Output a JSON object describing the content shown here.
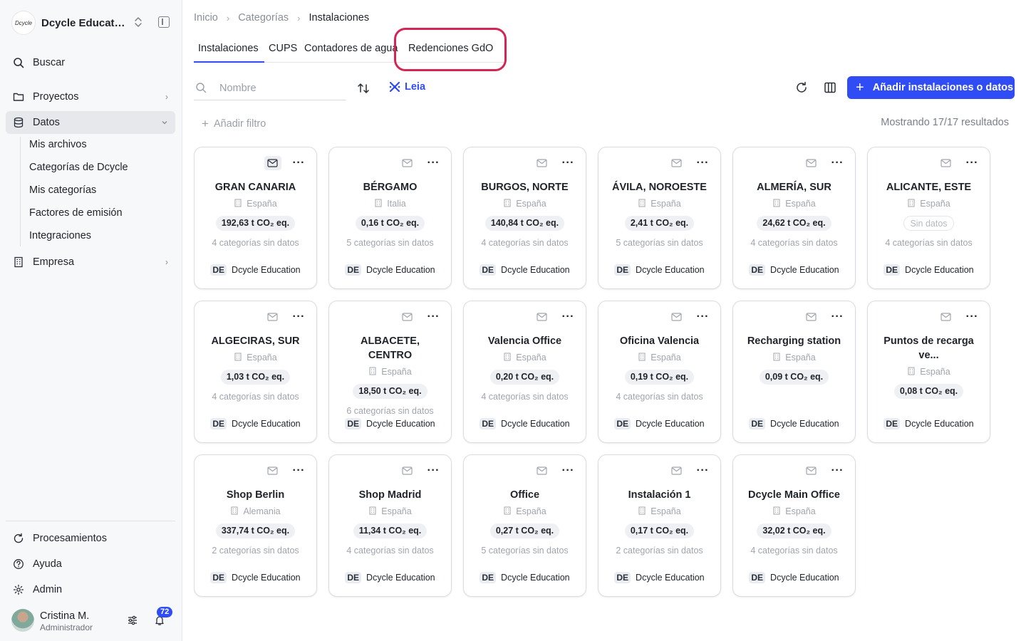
{
  "sidebar": {
    "org_logo_text": "Dcycle",
    "org_name": "Dcycle Education",
    "search_label": "Buscar",
    "projects_label": "Proyectos",
    "data_label": "Datos",
    "data_subitems": [
      "Mis archivos",
      "Categorías de Dcycle",
      "Mis categorías",
      "Factores de emisión",
      "Integraciones"
    ],
    "company_label": "Empresa",
    "processing_label": "Procesamientos",
    "help_label": "Ayuda",
    "admin_label": "Admin",
    "user_name": "Cristina M.",
    "user_role": "Administrador",
    "notifications_count": "72"
  },
  "breadcrumb": [
    "Inicio",
    "Categorías",
    "Instalaciones"
  ],
  "tabs": [
    "Instalaciones",
    "CUPS",
    "Contadores de agua",
    "Redenciones GdO"
  ],
  "active_tab": "Instalaciones",
  "toolbar": {
    "search_placeholder": "Nombre",
    "leia_label": "Leia",
    "add_button_label": "Añadir instalaciones o datos",
    "add_filter_label": "Añadir filtro",
    "results_text": "Mostrando 17/17 resultados"
  },
  "colors": {
    "accent": "#2f4cf5",
    "highlight": "#d42655"
  },
  "cards": [
    {
      "title": "GRAN CANARIA",
      "country": "España",
      "co2": "192,63 t CO₂ eq.",
      "nodata": "4 categorías sin datos",
      "owner_initials": "DE",
      "owner": "Dcycle Education",
      "mail_active": true
    },
    {
      "title": "BÉRGAMO",
      "country": "Italia",
      "co2": "0,16 t CO₂ eq.",
      "nodata": "5 categorías sin datos",
      "owner_initials": "DE",
      "owner": "Dcycle Education"
    },
    {
      "title": "BURGOS, NORTE",
      "country": "España",
      "co2": "140,84 t CO₂ eq.",
      "nodata": "4 categorías sin datos",
      "owner_initials": "DE",
      "owner": "Dcycle Education"
    },
    {
      "title": "ÁVILA, NOROESTE",
      "country": "España",
      "co2": "2,41 t CO₂ eq.",
      "nodata": "5 categorías sin datos",
      "owner_initials": "DE",
      "owner": "Dcycle Education"
    },
    {
      "title": "ALMERÍA, SUR",
      "country": "España",
      "co2": "24,62 t CO₂ eq.",
      "nodata": "4 categorías sin datos",
      "owner_initials": "DE",
      "owner": "Dcycle Education"
    },
    {
      "title": "ALICANTE, ESTE",
      "country": "España",
      "co2": "Sin datos",
      "co2_empty": true,
      "nodata": "4 categorías sin datos",
      "owner_initials": "DE",
      "owner": "Dcycle Education"
    },
    {
      "title": "ALGECIRAS, SUR",
      "country": "España",
      "co2": "1,03 t CO₂ eq.",
      "nodata": "4 categorías sin datos",
      "owner_initials": "DE",
      "owner": "Dcycle Education"
    },
    {
      "title": "ALBACETE, CENTRO",
      "country": "España",
      "co2": "18,50 t CO₂ eq.",
      "nodata": "6 categorías sin datos",
      "owner_initials": "DE",
      "owner": "Dcycle Education"
    },
    {
      "title": "Valencia Office",
      "country": "España",
      "co2": "0,20 t CO₂ eq.",
      "nodata": "4 categorías sin datos",
      "owner_initials": "DE",
      "owner": "Dcycle Education"
    },
    {
      "title": "Oficina Valencia",
      "country": "España",
      "co2": "0,19 t CO₂ eq.",
      "nodata": "4 categorías sin datos",
      "owner_initials": "DE",
      "owner": "Dcycle Education"
    },
    {
      "title": "Recharging station",
      "country": "España",
      "co2": "0,09 t CO₂ eq.",
      "nodata": "",
      "owner_initials": "DE",
      "owner": "Dcycle Education"
    },
    {
      "title": "Puntos de recarga ve...",
      "country": "España",
      "co2": "0,08 t CO₂ eq.",
      "nodata": "",
      "owner_initials": "DE",
      "owner": "Dcycle Education"
    },
    {
      "title": "Shop Berlin",
      "country": "Alemania",
      "co2": "337,74 t CO₂ eq.",
      "nodata": "2 categorías sin datos",
      "owner_initials": "DE",
      "owner": "Dcycle Education"
    },
    {
      "title": "Shop Madrid",
      "country": "España",
      "co2": "11,34 t CO₂ eq.",
      "nodata": "4 categorías sin datos",
      "owner_initials": "DE",
      "owner": "Dcycle Education"
    },
    {
      "title": "Office",
      "country": "España",
      "co2": "0,27 t CO₂ eq.",
      "nodata": "5 categorías sin datos",
      "owner_initials": "DE",
      "owner": "Dcycle Education"
    },
    {
      "title": "Instalación 1",
      "country": "España",
      "co2": "0,17 t CO₂ eq.",
      "nodata": "2 categorías sin datos",
      "owner_initials": "DE",
      "owner": "Dcycle Education"
    },
    {
      "title": "Dcycle Main Office",
      "country": "España",
      "co2": "32,02 t CO₂ eq.",
      "nodata": "4 categorías sin datos",
      "owner_initials": "DE",
      "owner": "Dcycle Education"
    }
  ]
}
